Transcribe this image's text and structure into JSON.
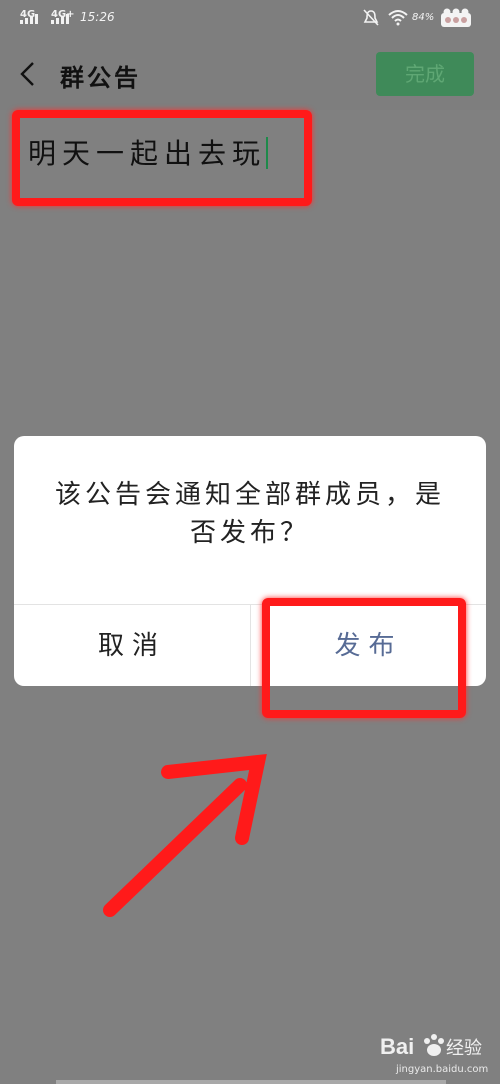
{
  "status_bar": {
    "network1": "4G",
    "network2": "4G+",
    "time": "15:26",
    "battery": "84%"
  },
  "header": {
    "back_icon": "chevron-left-icon",
    "title": "群公告",
    "done_label": "完成"
  },
  "editor": {
    "text": "明天一起出去玩"
  },
  "dialog": {
    "message": "该公告会通知全部群成员，是否发布？",
    "cancel_label": "取消",
    "publish_label": "发布"
  },
  "colors": {
    "overlay": "#7e7e7e",
    "done_button": "#3f8a59",
    "publish_text": "#576b95",
    "annotation": "#ff1a1a"
  },
  "watermark": {
    "brand": "Baidu经验",
    "url": "jingyan.baidu.com"
  }
}
